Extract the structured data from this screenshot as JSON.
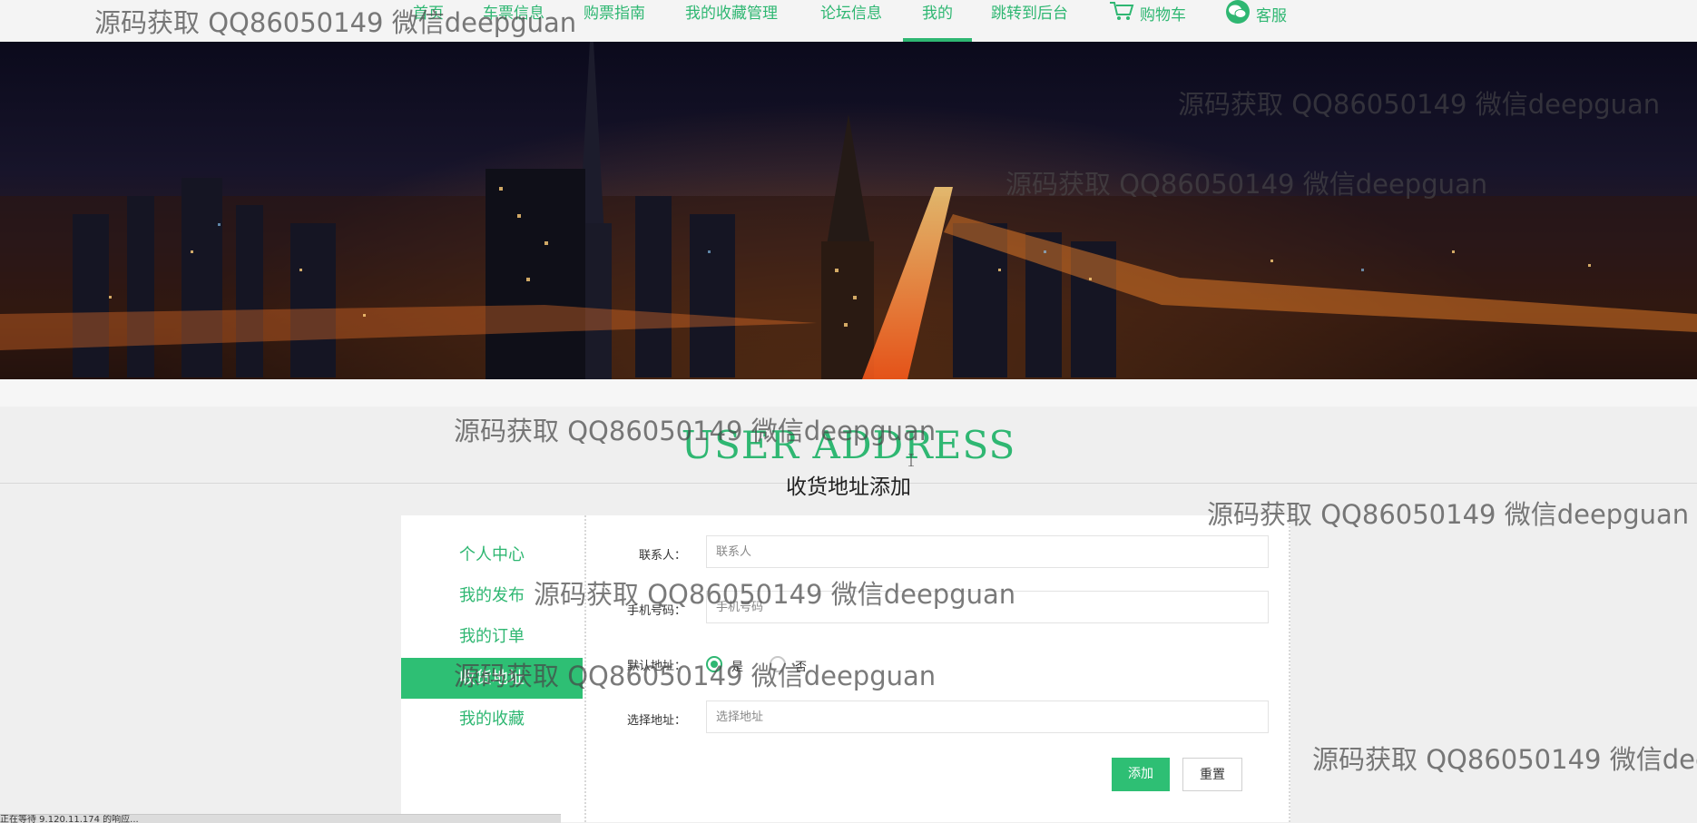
{
  "nav": {
    "items": [
      {
        "label": "首页"
      },
      {
        "label": "车票信息"
      },
      {
        "label": "购票指南"
      },
      {
        "label": "我的收藏管理"
      },
      {
        "label": "论坛信息"
      },
      {
        "label": "我的"
      },
      {
        "label": "跳转到后台"
      },
      {
        "label": "购物车",
        "icon": "cart-icon"
      },
      {
        "label": "客服",
        "icon": "wechat-icon"
      }
    ],
    "active": "我的"
  },
  "banner": {
    "description_icon": "city-night-skyline"
  },
  "section": {
    "title": "USER ADDRESS",
    "subtitle": "收货地址添加"
  },
  "sidebar": {
    "items": [
      {
        "label": "个人中心"
      },
      {
        "label": "我的发布"
      },
      {
        "label": "我的订单"
      },
      {
        "label": "收货地址"
      },
      {
        "label": "我的收藏"
      }
    ],
    "active_index": 3
  },
  "form": {
    "contact_label": "联系人：",
    "contact_placeholder": "联系人",
    "phone_label": "手机号码：",
    "phone_placeholder": "手机号码",
    "default_label": "默认地址：",
    "default_yes": "是",
    "default_no": "否",
    "address_label": "选择地址：",
    "address_placeholder": "选择地址",
    "submit_label": "添加",
    "reset_label": "重置"
  },
  "watermark": {
    "text": "源码获取 QQ86050149 微信deepguan"
  },
  "statusbar": {
    "text": "正在等待 9.120.11.174 的响应..."
  },
  "colors": {
    "accent": "#2fb772",
    "accent_active_bg": "#2ebf74",
    "page_bg": "#efefef"
  }
}
